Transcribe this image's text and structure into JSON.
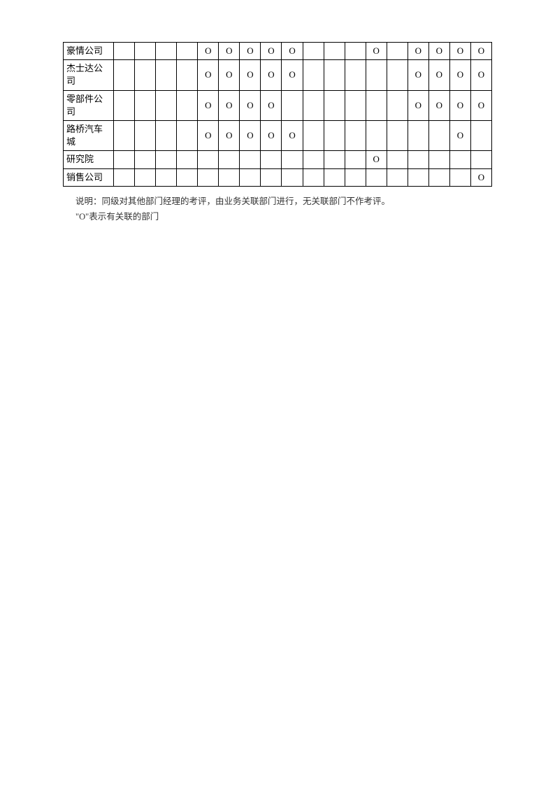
{
  "table": {
    "rows": [
      {
        "label": "豪情公司",
        "cells": [
          "",
          "",
          "",
          "",
          "O",
          "O",
          "O",
          "O",
          "O",
          "",
          "",
          "",
          "O",
          "",
          "O",
          "O",
          "O",
          "O"
        ]
      },
      {
        "label": "杰士达公司",
        "cells": [
          "",
          "",
          "",
          "",
          "O",
          "O",
          "O",
          "O",
          "O",
          "",
          "",
          "",
          "",
          "",
          "O",
          "O",
          "O",
          "O"
        ]
      },
      {
        "label": "零部件公司",
        "cells": [
          "",
          "",
          "",
          "",
          "O",
          "O",
          "O",
          "O",
          "",
          "",
          "",
          "",
          "",
          "",
          "O",
          "O",
          "O",
          "O"
        ]
      },
      {
        "label": "路桥汽车城",
        "cells": [
          "",
          "",
          "",
          "",
          "O",
          "O",
          "O",
          "O",
          "O",
          "",
          "",
          "",
          "",
          "",
          "",
          "",
          "O",
          ""
        ]
      },
      {
        "label": "研究院",
        "cells": [
          "",
          "",
          "",
          "",
          "",
          "",
          "",
          "",
          "",
          "",
          "",
          "",
          "O",
          "",
          "",
          "",
          "",
          ""
        ]
      },
      {
        "label": "销售公司",
        "cells": [
          "",
          "",
          "",
          "",
          "",
          "",
          "",
          "",
          "",
          "",
          "",
          "",
          "",
          "",
          "",
          "",
          "",
          "O"
        ]
      }
    ]
  },
  "notes": {
    "line1": "说明：同级对其他部门经理的考评，由业务关联部门进行，无关联部门不作考评。",
    "line2": "\"O\"表示有关联的部门"
  }
}
